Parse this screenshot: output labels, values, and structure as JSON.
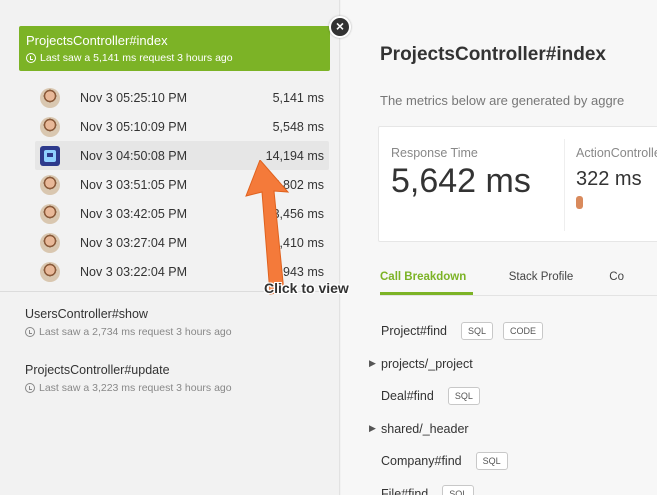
{
  "sidebar": {
    "active": {
      "title": "ProjectsController#index",
      "subtitle": "Last saw a 5,141 ms request 3 hours ago"
    },
    "requests": [
      {
        "time": "Nov 3 05:25:10 PM",
        "duration": "5,141 ms"
      },
      {
        "time": "Nov 3 05:10:09 PM",
        "duration": "5,548 ms"
      },
      {
        "time": "Nov 3 04:50:08 PM",
        "duration": "14,194 ms"
      },
      {
        "time": "Nov 3 03:51:05 PM",
        "duration": "5,802 ms"
      },
      {
        "time": "Nov 3 03:42:05 PM",
        "duration": "3,456 ms"
      },
      {
        "time": "Nov 3 03:27:04 PM",
        "duration": "3,410 ms"
      },
      {
        "time": "Nov 3 03:22:04 PM",
        "duration": "2,943 ms"
      }
    ],
    "endpoints": [
      {
        "name": "UsersController#show",
        "subtitle": "Last saw a 2,734 ms request 3 hours ago"
      },
      {
        "name": "ProjectsController#update",
        "subtitle": "Last saw a 3,223 ms request 3 hours ago"
      }
    ]
  },
  "close_label": "×",
  "main": {
    "title": "ProjectsController#index",
    "description": "The metrics below are generated by aggre",
    "metrics": {
      "response_time_label": "Response Time",
      "response_time_value": "5,642 ms",
      "action_label": "ActionControlle",
      "action_value": "322 ms"
    },
    "tabs": [
      "Call Breakdown",
      "Stack Profile",
      "Co"
    ],
    "call_breakdown": [
      {
        "name": "Project#find",
        "tags": [
          "SQL",
          "CODE"
        ],
        "expandable": false
      },
      {
        "name": "projects/_project",
        "tags": [],
        "expandable": true
      },
      {
        "name": "Deal#find",
        "tags": [
          "SQL"
        ],
        "expandable": false
      },
      {
        "name": "shared/_header",
        "tags": [],
        "expandable": true
      },
      {
        "name": "Company#find",
        "tags": [
          "SQL"
        ],
        "expandable": false
      },
      {
        "name": "File#find",
        "tags": [
          "SQL"
        ],
        "expandable": false
      }
    ]
  },
  "annotation": {
    "label": "Click to view"
  },
  "colors": {
    "accent": "#7cb326",
    "arrow": "#f47a3a"
  }
}
